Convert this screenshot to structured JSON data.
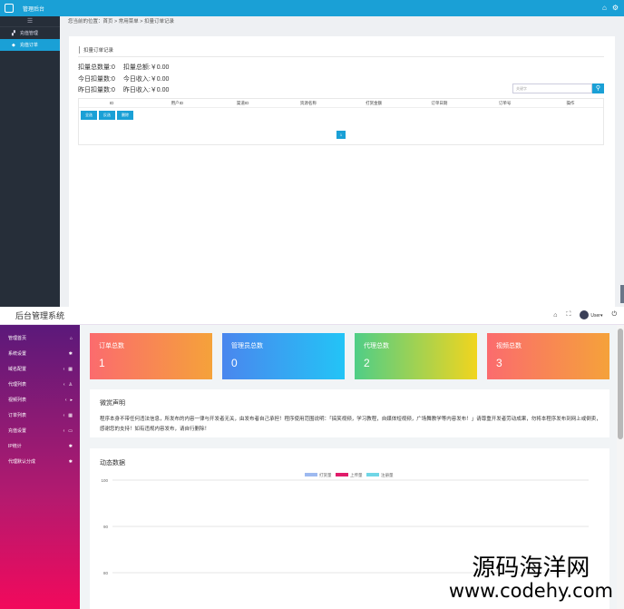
{
  "top_panel": {
    "app_title": "管理后台",
    "sidebar_items": [
      {
        "label": "充值管理",
        "icon": "sitemap-icon",
        "active": false
      },
      {
        "label": "充值订单",
        "icon": "tag-icon",
        "active": true
      }
    ],
    "breadcrumb": "您当前的位置：首页 > 常用菜单 > 扣量订单记录",
    "panel_header": "扣量订单记录",
    "stats": [
      {
        "left": "扣量总数量:0",
        "right": "扣量总额:￥0.00"
      },
      {
        "left": "今日扣量数:0",
        "right": "今日收入:￥0.00"
      },
      {
        "left": "昨日扣量数:0",
        "right": "昨日收入:￥0.00"
      }
    ],
    "search_placeholder": "关键字",
    "table_headers": [
      "ID",
      "用户ID",
      "渠道ID",
      "资源名称",
      "打赏金额",
      "订单日期",
      "订单号",
      "操作"
    ],
    "buttons": [
      "全选",
      "反选",
      "删除"
    ],
    "page_number": "1"
  },
  "bottom_panel": {
    "site_title": "后台管理系统",
    "user_label": "User",
    "sidebar_items": [
      {
        "label": "管理首页",
        "icon": "home-icon"
      },
      {
        "label": "系统设置",
        "icon": "gear-icon"
      },
      {
        "label": "域名配置",
        "icon": "grid-icon",
        "chevron": true
      },
      {
        "label": "代理列表",
        "icon": "user-icon",
        "chevron": true
      },
      {
        "label": "视频列表",
        "icon": "play-icon",
        "chevron": true
      },
      {
        "label": "订单列表",
        "icon": "grid-icon",
        "chevron": true
      },
      {
        "label": "充值设置",
        "icon": "monitor-icon",
        "chevron": true
      },
      {
        "label": "IP统计",
        "icon": "gear-icon"
      },
      {
        "label": "代理默认分成",
        "icon": "gear-icon"
      }
    ],
    "cards": [
      {
        "label": "订单总数",
        "value": "1",
        "from": "#fb6b6e",
        "to": "#f5a23a"
      },
      {
        "label": "管理员总数",
        "value": "0",
        "from": "#4a86ee",
        "to": "#23c4f6"
      },
      {
        "label": "代理总数",
        "value": "2",
        "from": "#4fce87",
        "to": "#f1d51e"
      },
      {
        "label": "视频总数",
        "value": "3",
        "from": "#fb6b6e",
        "to": "#f5a23a"
      }
    ],
    "disclaimer": {
      "title": "微赏声明",
      "text": "程序本身不带任何违法信息，所发布的内容一律与开发者无关，由发布者自己承担！程序使用范围说明：「搞笑视频，学习教程，自媒体短视频，广场舞教学等内容发布！」请尊重开发者劳动成果，勿将本程序发布到网上或倒卖，感谢您的支持！如有违规内容发布，请自行删除！"
    },
    "chart_section_title": "动态数据"
  },
  "chart_data": {
    "type": "line",
    "title": "",
    "series": [
      {
        "name": "打赏量",
        "color": "#9db9f0",
        "values": []
      },
      {
        "name": "上传量",
        "color": "#e11c6a",
        "values": []
      },
      {
        "name": "注册量",
        "color": "#6fd6e6",
        "values": []
      }
    ],
    "y_ticks": [
      "100",
      "90",
      "80"
    ],
    "grid": true,
    "legend_position": "top-center"
  },
  "watermark": {
    "cn": "源码海洋网",
    "en": "www.codehy.com"
  }
}
